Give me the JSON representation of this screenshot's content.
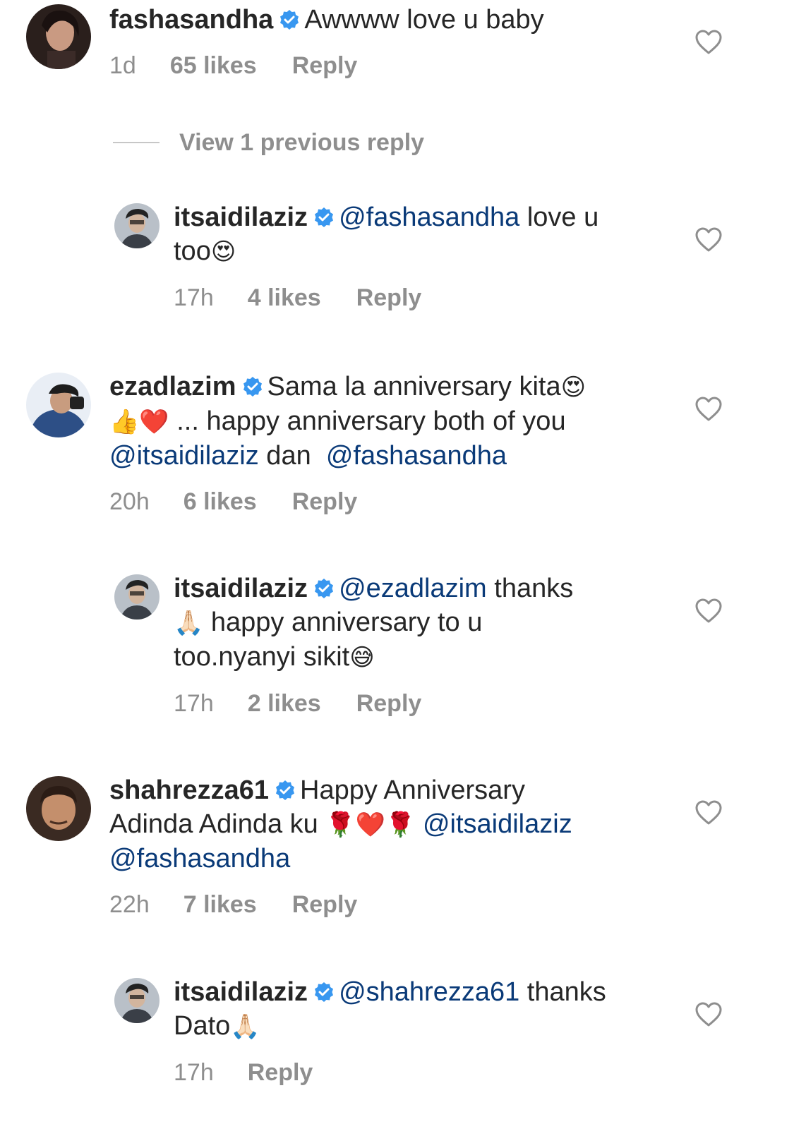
{
  "view_previous": "View 1 previous reply",
  "comments": [
    {
      "username": "fashasandha",
      "parts": [
        {
          "t": "Awwww love u baby"
        }
      ],
      "time": "1d",
      "likes": "65 likes",
      "reply": "Reply"
    },
    {
      "username": "itsaidilaziz",
      "mention1": "@fashasandha",
      "text1": " love u",
      "text2": "too",
      "emoji1": "😍",
      "time": "17h",
      "likes": "4 likes",
      "reply": "Reply"
    },
    {
      "username": "ezadlazim",
      "text1": "Sama la anniversary kita",
      "emoji1": "😍",
      "emoji2": "👍",
      "emoji3": "❤️",
      "text2": " ... happy anniversary both of you",
      "mention1": "@itsaidilaziz",
      "text3": " dan  ",
      "mention2": "@fashasandha",
      "time": "20h",
      "likes": "6 likes",
      "reply": "Reply"
    },
    {
      "username": "itsaidilaziz",
      "mention1": "@ezadlazim",
      "text1": " thanks",
      "emoji1": "🙏🏻",
      "text2": " happy anniversary to u",
      "text3": "too.nyanyi sikit",
      "emoji2": "😅",
      "time": "17h",
      "likes": "2 likes",
      "reply": "Reply"
    },
    {
      "username": "shahrezza61",
      "text1": "Happy Anniversary",
      "text2": "Adinda Adinda ku ",
      "emoji1": "🌹",
      "emoji2": "❤️",
      "emoji3": "🌹",
      "mention1": "@itsaidilaziz",
      "mention2": "@fashasandha",
      "time": "22h",
      "likes": "7 likes",
      "reply": "Reply"
    },
    {
      "username": "itsaidilaziz",
      "mention1": "@shahrezza61",
      "text1": " thanks",
      "text2": "Dato",
      "emoji1": "🙏🏻",
      "time": "17h",
      "reply": "Reply"
    }
  ]
}
